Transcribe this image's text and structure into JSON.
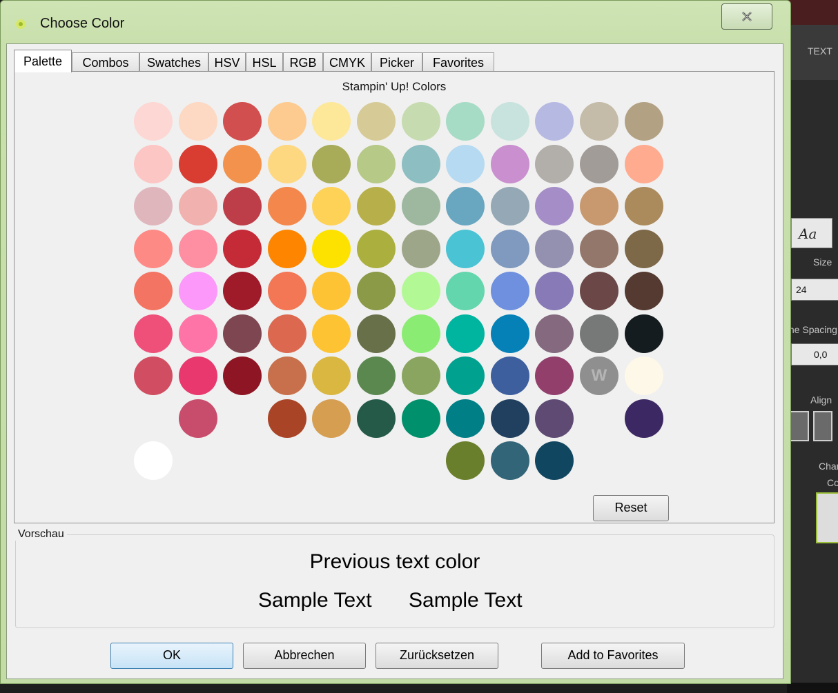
{
  "background_app": {
    "header_label": "TEXT",
    "font_button_label": "Aa",
    "size_label": "Size",
    "size_value": "24",
    "line_spacing_label": "Line Spacing",
    "line_spacing_value": "0,0",
    "align_label": "Align",
    "char_label": "Char",
    "color_label": "Co"
  },
  "dialog": {
    "title": "Choose Color",
    "tabs": [
      {
        "label": "Palette",
        "active": true
      },
      {
        "label": "Combos",
        "active": false
      },
      {
        "label": "Swatches",
        "active": false
      },
      {
        "label": "HSV",
        "active": false
      },
      {
        "label": "HSL",
        "active": false
      },
      {
        "label": "RGB",
        "active": false
      },
      {
        "label": "CMYK",
        "active": false
      },
      {
        "label": "Picker",
        "active": false
      },
      {
        "label": "Favorites",
        "active": false
      }
    ],
    "palette_title": "Stampin' Up! Colors",
    "palette_rows": [
      [
        "#fdd7d3",
        "#fdd8c3",
        "#d24f4f",
        "#fdcb90",
        "#fde89a",
        "#d6cb97",
        "#c6dcb0",
        "#a6dcc6",
        "#c8e3dd",
        "#b6b9e2",
        "#c4bba8",
        "#b3a184"
      ],
      [
        "#fcc6c4",
        "#d93c31",
        "#f3924c",
        "#fed881",
        "#a8ab58",
        "#b6c987",
        "#8dbec2",
        "#b6daf1",
        "#c98fcf",
        "#b2aeaa",
        "#a19c98",
        "#ffab90"
      ],
      [
        "#e0b6bd",
        "#f1b1ae",
        "#bd3e49",
        "#f4874c",
        "#fed157",
        "#b7b04a",
        "#9db89f",
        "#69a6c0",
        "#94a8b5",
        "#a58ec7",
        "#c8996f",
        "#ab8a5c"
      ],
      [
        "#fe8a86",
        "#fe8ea2",
        "#c52a37",
        "#fd8500",
        "#fde200",
        "#abaf3e",
        "#9ea689",
        "#4ac3d4",
        "#7f99bf",
        "#9491b0",
        "#94776b",
        "#7d6848"
      ],
      [
        "#f47463",
        "#fc98f9",
        "#9f1b2a",
        "#f37655",
        "#fec334",
        "#8a9a47",
        "#b2f894",
        "#64d6ad",
        "#6e90df",
        "#8879b7",
        "#6b4847",
        "#543a30"
      ],
      [
        "#ef5079",
        "#ff74a7",
        "#7e4651",
        "#dc684f",
        "#fec333",
        "#677049",
        "#8bec73",
        "#00b5a0",
        "#0581b7",
        "#84697f",
        "#767977",
        "#141c1f"
      ],
      [
        "#d14e62",
        "#e8386d",
        "#8e1524",
        "#c8704b",
        "#d9b741",
        "#5b884f",
        "#8aa560",
        "#00a18f",
        "#3d5f9e",
        "#923f6c",
        "#8f8f8f",
        "#fdf8e8"
      ],
      [
        null,
        "#c84c6b",
        null,
        "#aa4426",
        "#d69e51",
        "#255a48",
        "#00906b",
        "#007f86",
        "#21405f",
        "#5e4a73",
        null,
        "#3c2862"
      ],
      [
        "#ffffff",
        null,
        null,
        null,
        null,
        null,
        null,
        "#6a7f2c",
        "#326578",
        "#114660",
        null,
        null
      ]
    ],
    "watermark_letter": "W",
    "reset_label": "Reset",
    "preview": {
      "legend": "Vorschau",
      "previous_text": "Previous text color",
      "sample_text_1": "Sample Text",
      "sample_text_2": "Sample Text"
    },
    "buttons": {
      "ok": "OK",
      "cancel": "Abbrechen",
      "reset": "Zurücksetzen",
      "add_favorites": "Add to Favorites"
    }
  }
}
